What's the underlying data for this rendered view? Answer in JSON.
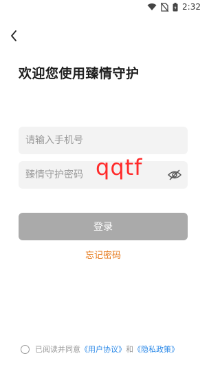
{
  "status_bar": {
    "time": "2:32"
  },
  "login": {
    "title": "欢迎您使用臻情守护",
    "phone_placeholder": "请输入手机号",
    "password_placeholder": "臻情守护密码",
    "typed_overlay": "qqtf",
    "login_button": "登录",
    "forgot_password": "忘记密码"
  },
  "agreement": {
    "prefix": "已阅读并同意",
    "user_agreement": "《用户协议》",
    "and": "和",
    "privacy_policy": "《隐私政策》"
  },
  "colors": {
    "accent_orange": "#e67a1c",
    "link_blue": "#2d8ae8",
    "button_disabled": "#aaaaaa",
    "overlay_red": "#ff2a2a"
  },
  "icons": [
    "wifi-icon",
    "no-sim-icon",
    "battery-icon",
    "back-arrow-icon",
    "eye-off-icon"
  ]
}
